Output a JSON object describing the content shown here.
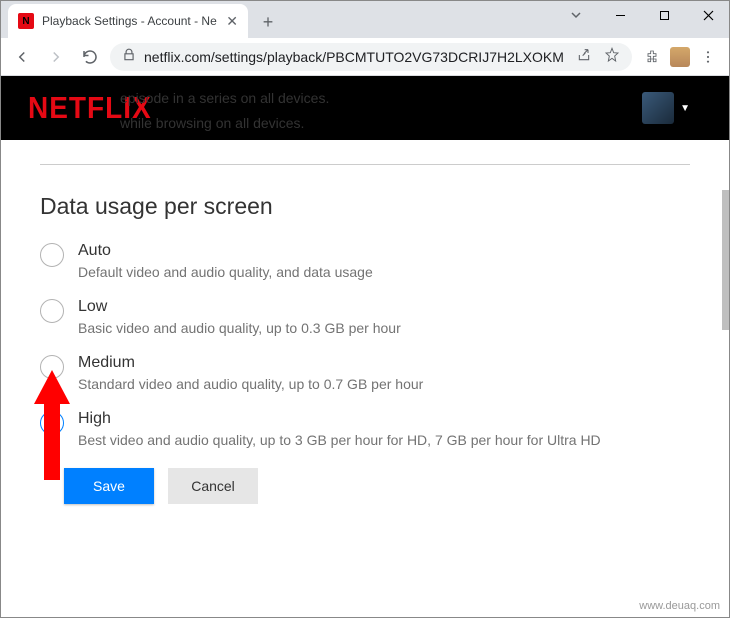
{
  "browser": {
    "tab_title": "Playback Settings - Account - Ne",
    "url": "netflix.com/settings/playback/PBCMTUTO2VG73DCRIJ7H2LXOKM"
  },
  "header": {
    "logo_text": "NETFLIX",
    "faded_line1": "episode in a series on all devices.",
    "faded_line2": "while browsing on all devices."
  },
  "page": {
    "heading": "Data usage per screen",
    "options": [
      {
        "id": "auto",
        "title": "Auto",
        "desc": "Default video and audio quality, and data usage",
        "selected": false
      },
      {
        "id": "low",
        "title": "Low",
        "desc": "Basic video and audio quality, up to 0.3 GB per hour",
        "selected": false
      },
      {
        "id": "medium",
        "title": "Medium",
        "desc": "Standard video and audio quality, up to 0.7 GB per hour",
        "selected": false
      },
      {
        "id": "high",
        "title": "High",
        "desc": "Best video and audio quality, up to 3 GB per hour for HD, 7 GB per hour for Ultra HD",
        "selected": true
      }
    ],
    "save_label": "Save",
    "cancel_label": "Cancel"
  },
  "watermark": "www.deuaq.com"
}
